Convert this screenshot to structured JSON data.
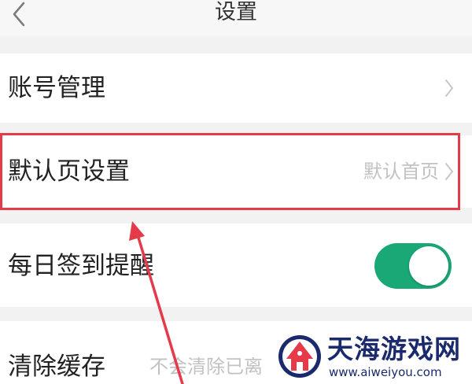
{
  "header": {
    "title": "设置",
    "back_icon": "chevron-left-icon"
  },
  "settings": {
    "account": {
      "label": "账号管理"
    },
    "default_page": {
      "label": "默认页设置",
      "value": "默认首页"
    },
    "daily_checkin_reminder": {
      "label": "每日签到提醒",
      "toggle_on": true
    },
    "clear_cache": {
      "label": "清除缓存",
      "note": "不会清除已离"
    }
  },
  "annotation": {
    "highlight_color": "#e43a4a"
  },
  "watermark": {
    "name": "天海游戏网",
    "url": "www.aiweiyou.com"
  },
  "colors": {
    "accent_green": "#1aa876",
    "background": "#f2f2f2"
  }
}
